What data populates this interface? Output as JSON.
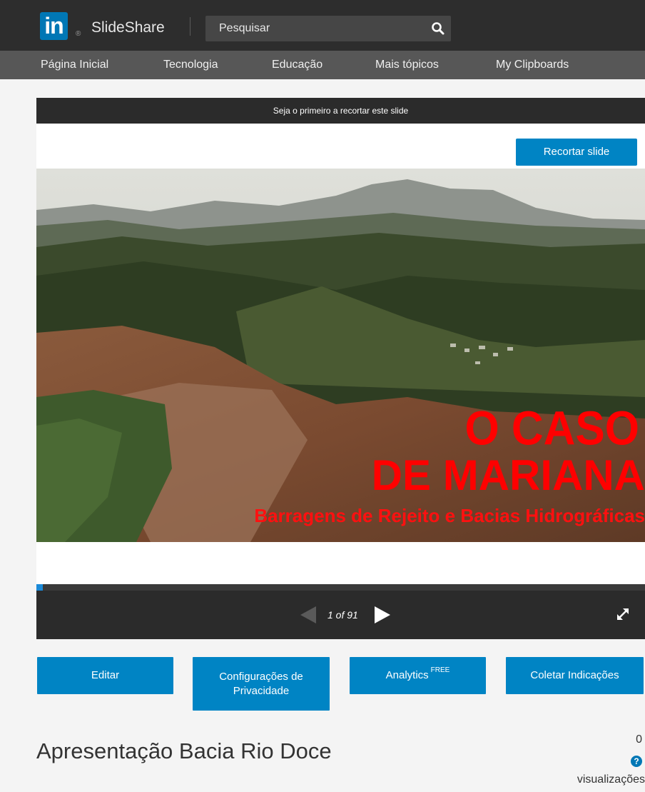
{
  "header": {
    "logo_text": "in",
    "registered": "®",
    "brand": "SlideShare",
    "search_placeholder": "Pesquisar",
    "search_icon": "search-icon"
  },
  "nav": {
    "items": [
      "Página Inicial",
      "Tecnologia",
      "Educação",
      "Mais tópicos",
      "My Clipboards"
    ]
  },
  "player": {
    "top_message": "Seja o primeiro a recortar este slide",
    "clip_button": "Recortar slide",
    "slide": {
      "line1": "O CASO",
      "line2": "DE MARIANA",
      "line3": "Barragens de Rejeito e Bacias Hidrográficas"
    },
    "counter": "1 of 91",
    "progress_fraction": 0.011
  },
  "actions": {
    "edit": "Editar",
    "privacy": "Configurações de Privacidade",
    "analytics": "Analytics",
    "analytics_badge": "FREE",
    "collect": "Coletar Indicações"
  },
  "presentation": {
    "title": "Apresentação Bacia Rio Doce",
    "views_count": "0",
    "views_label": "visualizações",
    "help_icon": "?"
  },
  "colors": {
    "brand_blue": "#0077b5",
    "button_blue": "#0084c4",
    "slide_text_red": "#ff0000"
  }
}
